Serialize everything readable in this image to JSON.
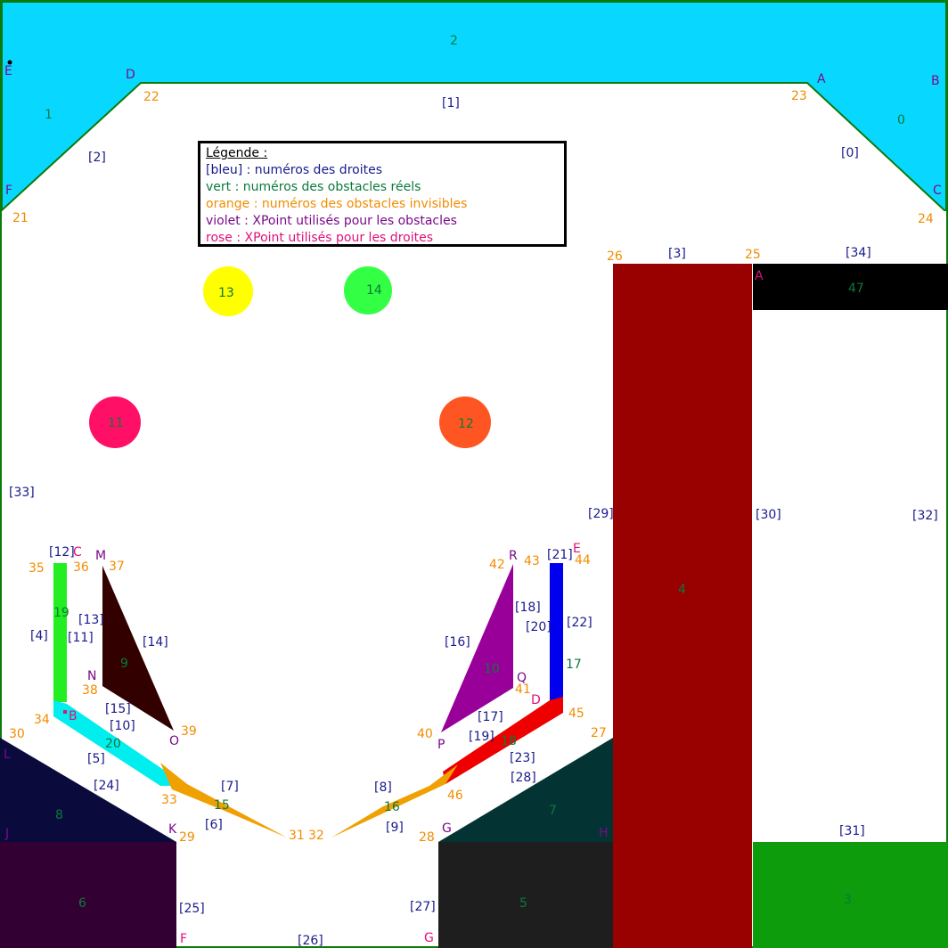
{
  "legend": {
    "title": "Légende :",
    "blue": "[bleu] : numéros des droites",
    "green": "vert : numéros des obstacles réels",
    "orange": "orange : numéros des obstacles invisibles",
    "violet": "violet : XPoint utilisés pour les obstacles",
    "rose": "rose : XPoint utilisés pour les droites"
  },
  "colors": {
    "cyan": "#08d8ff",
    "dark_red": "#990000",
    "black": "#000000",
    "dark_green": "#0c9c0c",
    "navy": "#0a0a3c",
    "dark_teal": "#033333",
    "dark_purple": "#330033",
    "dark_gray": "#1e1e1e",
    "bright_green": "#22ee22",
    "dark_brown": "#330000",
    "purple": "#990099",
    "blue": "#0000ee",
    "red": "#ee0000",
    "orange": "#f0a000",
    "yellow": "#ffff00",
    "lime": "#33ff44",
    "pink": "#ff1066",
    "orange_red": "#ff5522"
  },
  "blue_labels": [
    "[1]",
    "[2]",
    "[0]",
    "[3]",
    "[34]",
    "[33]",
    "[29]",
    "[30]",
    "[32]",
    "[12]",
    "[4]",
    "[11]",
    "[13]",
    "[14]",
    "[15]",
    "[10]",
    "[5]",
    "[24]",
    "[7]",
    "[6]",
    "[25]",
    "[26]",
    "[8]",
    "[9]",
    "[27]",
    "[16]",
    "[18]",
    "[20]",
    "[21]",
    "[22]",
    "[17]",
    "[19]",
    "[23]",
    "[28]",
    "[31]"
  ],
  "green_labels": [
    "2",
    "1",
    "0",
    "47",
    "4",
    "13",
    "14",
    "11",
    "12",
    "19",
    "9",
    "20",
    "15",
    "8",
    "6",
    "16",
    "10",
    "17",
    "18",
    "7",
    "5",
    "3"
  ],
  "orange_labels": [
    "22",
    "23",
    "21",
    "24",
    "26",
    "25",
    "35",
    "36",
    "37",
    "38",
    "34",
    "39",
    "30",
    "33",
    "29",
    "31",
    "32",
    "40",
    "42",
    "43",
    "41",
    "45",
    "44",
    "27",
    "46",
    "28"
  ],
  "violet_labels": [
    "E",
    "D",
    "A",
    "B",
    "F",
    "C",
    "M",
    "N",
    "O",
    "L",
    "J",
    "K",
    "R",
    "Q",
    "P",
    "G",
    "H"
  ],
  "rose_labels": [
    "A",
    "C",
    "B",
    "E",
    "D",
    "F",
    "G"
  ]
}
